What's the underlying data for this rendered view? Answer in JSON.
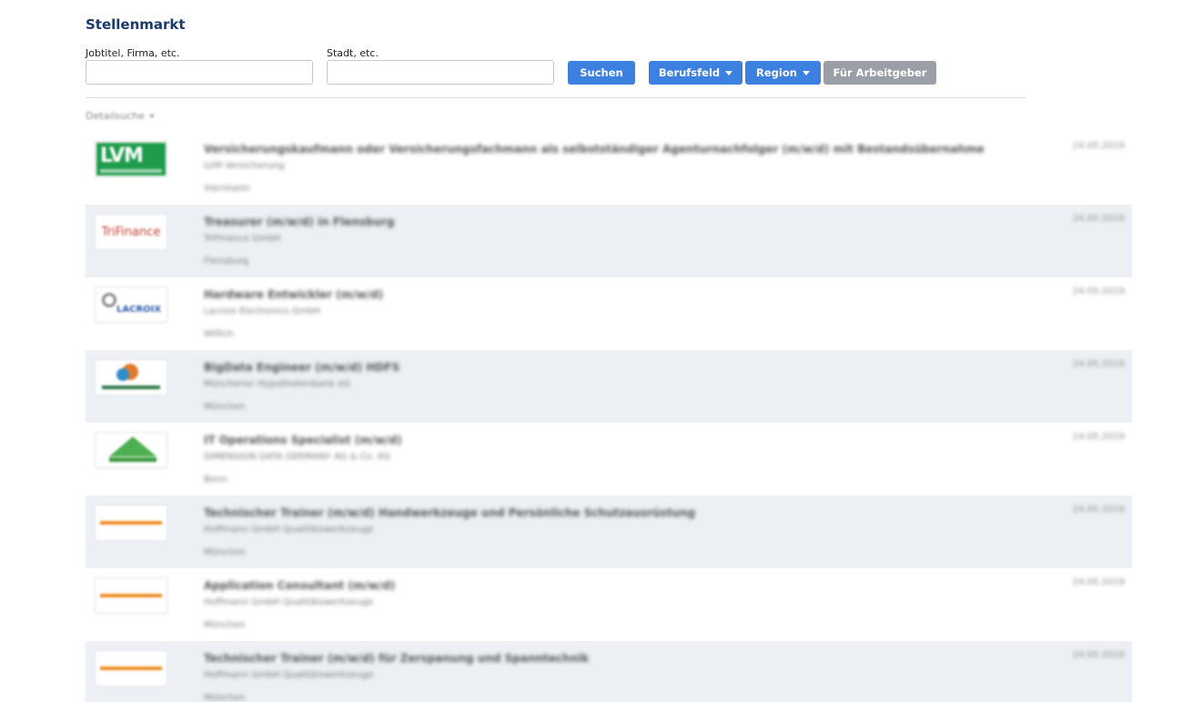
{
  "page": {
    "title": "Stellenmarkt"
  },
  "search": {
    "job_label": "Jobtitel, Firma, etc.",
    "job_value": "",
    "job_placeholder": "",
    "city_label": "Stadt, etc.",
    "city_value": "",
    "city_placeholder": "",
    "search_button": "Suchen",
    "berufsfeld_button": "Berufsfeld",
    "region_button": "Region",
    "employer_button": "Für Arbeitgeber",
    "detail_search": "Detailsuche"
  },
  "colors": {
    "accent": "#3c80e0",
    "title": "#1c3a6b",
    "row_alt": "#ecf0f4",
    "employer_button": "#9a9ea6"
  },
  "jobs": [
    {
      "logo": "lvm-logo",
      "title": "Versicherungskaufmann oder Versicherungsfachmann als selbstständiger Agenturnachfolger (m/w/d) mit Bestandsübernahme",
      "company": "LVM Versicherung",
      "city": "Viernheim",
      "date": "24.05.2019"
    },
    {
      "logo": "trifinance-logo",
      "title": "Treasurer (m/w/d) in Flensburg",
      "company": "TriFinance GmbH",
      "city": "Flensburg",
      "date": "24.05.2019",
      "logo_text": "TriFinance"
    },
    {
      "logo": "lacroix-logo",
      "title": "Hardware Entwickler (m/w/d)",
      "company": "Lacroix Electronics GmbH",
      "city": "Willich",
      "date": "24.05.2019",
      "logo_text": "LACROIX"
    },
    {
      "logo": "mhb-logo",
      "title": "BigData Engineer (m/w/d) HDFS",
      "company": "Münchener Hypothekenbank eG",
      "city": "München",
      "date": "24.05.2019"
    },
    {
      "logo": "dd-logo",
      "title": "IT Operations Specialist (m/w/d)",
      "company": "DIMENSION DATA GERMANY AG & Co. KG",
      "city": "Bonn",
      "date": "24.05.2019"
    },
    {
      "logo": "hoffmann-logo",
      "title": "Technischer Trainer (m/w/d) Handwerkzeuge und Persönliche Schutzausrüstung",
      "company": "Hoffmann GmbH Qualitätswerkzeuge",
      "city": "München",
      "date": "24.05.2019"
    },
    {
      "logo": "hoffmann-logo",
      "title": "Application Consultant (m/w/d)",
      "company": "Hoffmann GmbH Qualitätswerkzeuge",
      "city": "München",
      "date": "24.05.2019"
    },
    {
      "logo": "hoffmann-logo",
      "title": "Technischer Trainer (m/w/d) für Zerspanung und Spanntechnik",
      "company": "Hoffmann GmbH Qualitätswerkzeuge",
      "city": "München",
      "date": "24.05.2019"
    }
  ]
}
